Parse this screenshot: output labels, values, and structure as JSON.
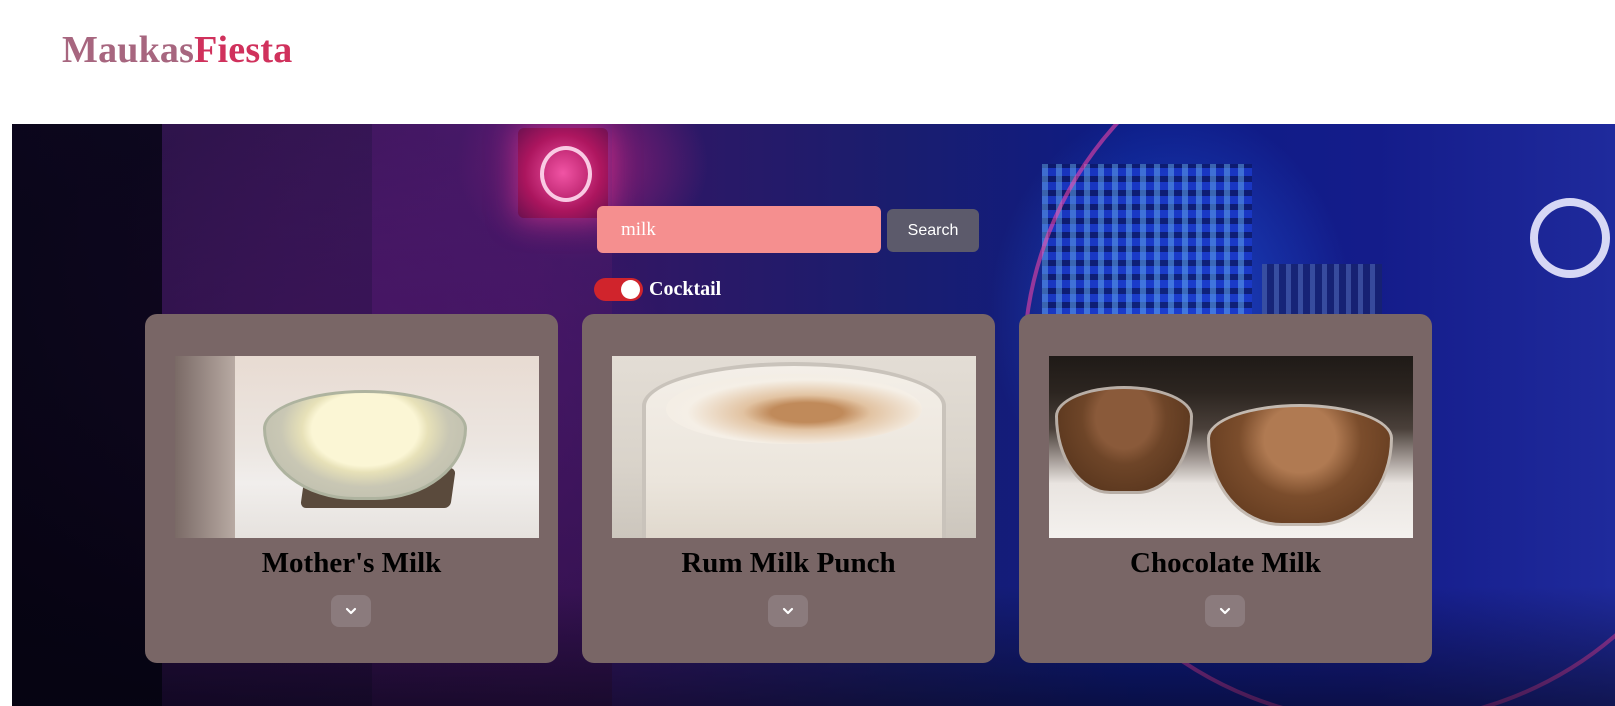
{
  "brand": {
    "part_a": "Maukas",
    "part_b": "Fiesta",
    "color_a": "#a7667f",
    "color_b": "#d0315c"
  },
  "search": {
    "value": "milk",
    "button_label": "Search"
  },
  "toggle": {
    "label": "Cocktail",
    "checked": true,
    "color": "#d0242c"
  },
  "results": [
    {
      "title": "Mother's Milk",
      "image_icon": "milk-bowl-image",
      "expand_icon": "chevron-down-icon"
    },
    {
      "title": "Rum Milk Punch",
      "image_icon": "milk-punch-image",
      "expand_icon": "chevron-down-icon"
    },
    {
      "title": "Chocolate Milk",
      "image_icon": "chocolate-milk-image",
      "expand_icon": "chevron-down-icon"
    }
  ],
  "colors": {
    "card_background": "#796666",
    "search_input": "#f58f8f",
    "search_button": "#5c5a6b"
  }
}
